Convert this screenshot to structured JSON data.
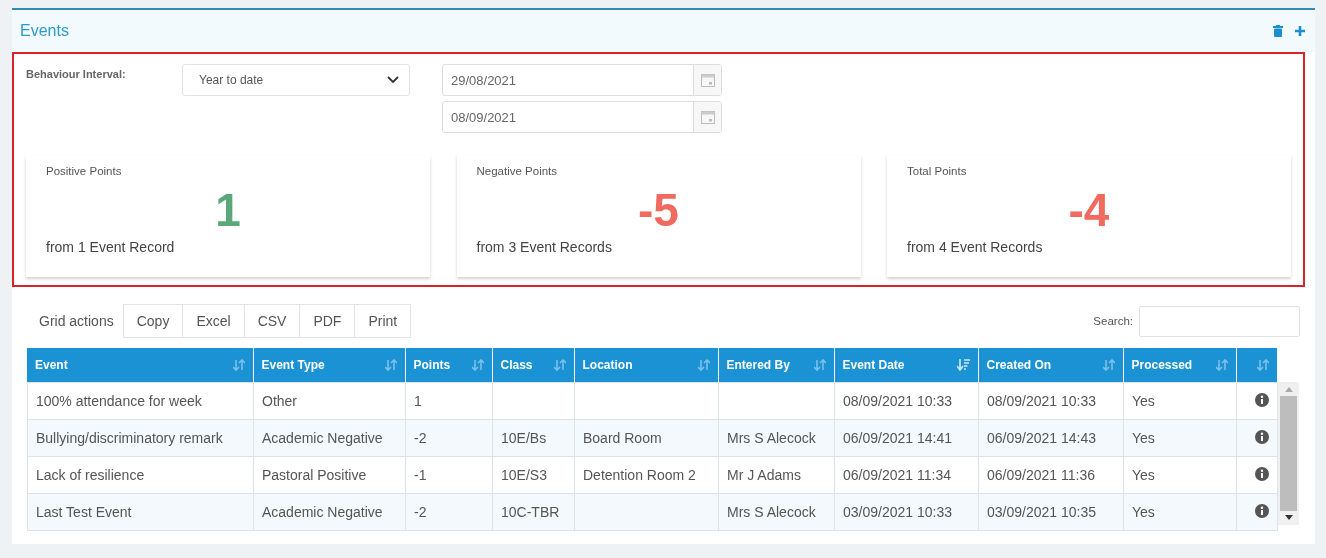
{
  "panel": {
    "title": "Events"
  },
  "filter": {
    "label": "Behaviour Interval:",
    "interval": "Year to date",
    "start_date": "29/08/2021",
    "end_date": "08/09/2021"
  },
  "cards": [
    {
      "title": "Positive Points",
      "value": "1",
      "kind": "positive",
      "footer": "from 1 Event Record"
    },
    {
      "title": "Negative Points",
      "value": "-5",
      "kind": "negative",
      "footer": "from 3 Event Records"
    },
    {
      "title": "Total Points",
      "value": "-4",
      "kind": "negative",
      "footer": "from 4 Event Records"
    }
  ],
  "grid_actions": {
    "label": "Grid actions",
    "buttons": [
      "Copy",
      "Excel",
      "CSV",
      "PDF",
      "Print"
    ]
  },
  "search": {
    "label": "Search:"
  },
  "table": {
    "columns": [
      {
        "label": "Event",
        "sorted": false
      },
      {
        "label": "Event Type",
        "sorted": false
      },
      {
        "label": "Points",
        "sorted": false
      },
      {
        "label": "Class",
        "sorted": false
      },
      {
        "label": "Location",
        "sorted": false
      },
      {
        "label": "Entered By",
        "sorted": false
      },
      {
        "label": "Event Date",
        "sorted": true
      },
      {
        "label": "Created On",
        "sorted": false
      },
      {
        "label": "Processed",
        "sorted": false
      },
      {
        "sorted": false
      }
    ],
    "rows": [
      [
        "100% attendance for week",
        "Other",
        "1",
        "",
        "",
        "",
        "08/09/2021 10:33",
        "08/09/2021 10:33",
        "Yes"
      ],
      [
        "Bullying/discriminatory remark",
        "Academic Negative",
        "-2",
        "10E/Bs",
        "Board Room",
        "Mrs S Alecock",
        "06/09/2021 14:41",
        "06/09/2021 14:43",
        "Yes"
      ],
      [
        "Lack of resilience",
        "Pastoral Positive",
        "-1",
        "10E/S3",
        "Detention Room 2",
        "Mr J Adams",
        "06/09/2021 11:34",
        "06/09/2021 11:36",
        "Yes"
      ],
      [
        "Last Test Event",
        "Academic Negative",
        "-2",
        "10C-TBR",
        "",
        "Mrs S Alecock",
        "03/09/2021 10:33",
        "03/09/2021 10:35",
        "Yes"
      ]
    ]
  }
}
